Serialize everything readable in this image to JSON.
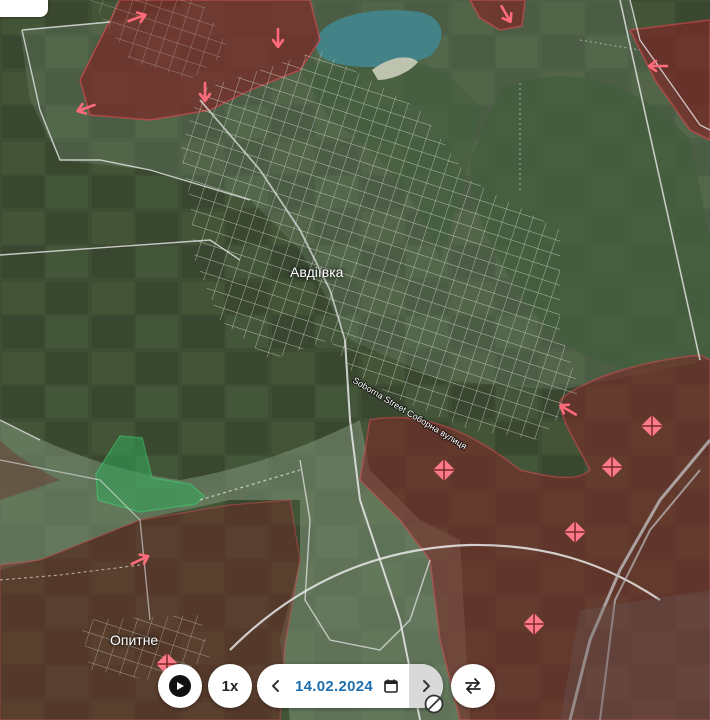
{
  "map": {
    "labels": {
      "city": "Авдіївка",
      "village": "Опитне",
      "street": "Sobornа Street Соборна вулиця"
    },
    "colors": {
      "occupied_fill": "#7a2a28",
      "front_line": "#d2434a",
      "contested_fill": "#6f8a6a",
      "liberated_fill": "#33a85a",
      "attack_arrow": "#ff6b7a",
      "fortification": "#ff7a8a",
      "road": "#e8e8e8"
    },
    "attack_arrow_icon": "attack-arrow-icon",
    "fortification_icon": "fortification-marker-icon"
  },
  "controls": {
    "play_icon": "play-icon",
    "speed": "1x",
    "prev_icon": "chevron-left-icon",
    "date": "14.02.2024",
    "calendar_icon": "calendar-icon",
    "next_icon": "chevron-right-icon",
    "blocked_icon": "blocked-cursor-icon",
    "swap_icon": "swap-arrows-icon"
  }
}
